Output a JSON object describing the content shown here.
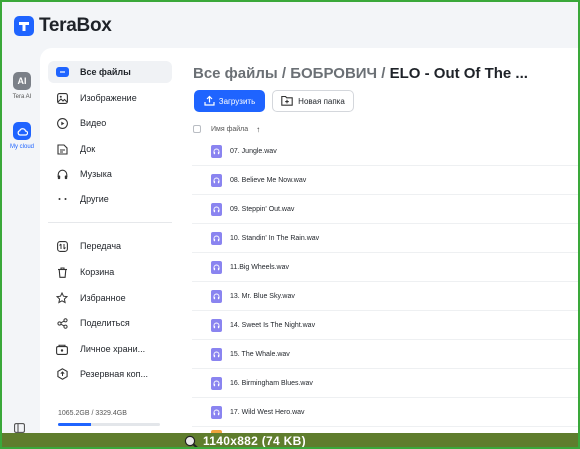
{
  "app": {
    "name": "TeraBox",
    "accent_color": "#1f64ff"
  },
  "rail": {
    "items": [
      {
        "label": "Tera AI",
        "icon": "ai-icon",
        "active": false
      },
      {
        "label": "My cloud",
        "icon": "cloud-icon",
        "active": true
      }
    ]
  },
  "sidebar": {
    "items_top": [
      {
        "label": "Все файлы",
        "icon": "all-files-icon",
        "active": true
      },
      {
        "label": "Изображение",
        "icon": "image-icon",
        "active": false
      },
      {
        "label": "Видео",
        "icon": "video-icon",
        "active": false
      },
      {
        "label": "Док",
        "icon": "document-icon",
        "active": false
      },
      {
        "label": "Музыка",
        "icon": "headphones-icon",
        "active": false
      },
      {
        "label": "Другие",
        "icon": "more-icon",
        "active": false
      }
    ],
    "items_bottom": [
      {
        "label": "Передача",
        "icon": "transfer-icon"
      },
      {
        "label": "Корзина",
        "icon": "trash-icon"
      },
      {
        "label": "Избранное",
        "icon": "star-icon"
      },
      {
        "label": "Поделиться",
        "icon": "share-icon"
      },
      {
        "label": "Личное храни...",
        "icon": "private-storage-icon"
      },
      {
        "label": "Резервная коп...",
        "icon": "backup-icon"
      }
    ],
    "storage": {
      "text": "1065.2GB / 3329.4GB",
      "used_fraction": 0.32
    }
  },
  "main": {
    "breadcrumb": {
      "root": "Все файлы",
      "sep1": " / ",
      "folder": "БОБРОВИЧ",
      "sep2": " / ",
      "current": "ELO - Out Of The ..."
    },
    "upload_label": "Загрузить",
    "new_folder_label": "Новая папка",
    "column_name": "Имя файла",
    "sort_arrow": "↑",
    "files": [
      "07. Jungle.wav",
      "08. Believe Me Now.wav",
      "09. Steppin' Out.wav",
      "10. Standin' In The Rain.wav",
      "11.Big Wheels.wav",
      "13. Mr. Blue Sky.wav",
      "14. Sweet Is The Night.wav",
      "15. The Whale.wav",
      "16. Birmingham Blues.wav",
      "17. Wild West Hero.wav"
    ]
  },
  "overlay": {
    "text": "1140x882 (74 KB)"
  }
}
